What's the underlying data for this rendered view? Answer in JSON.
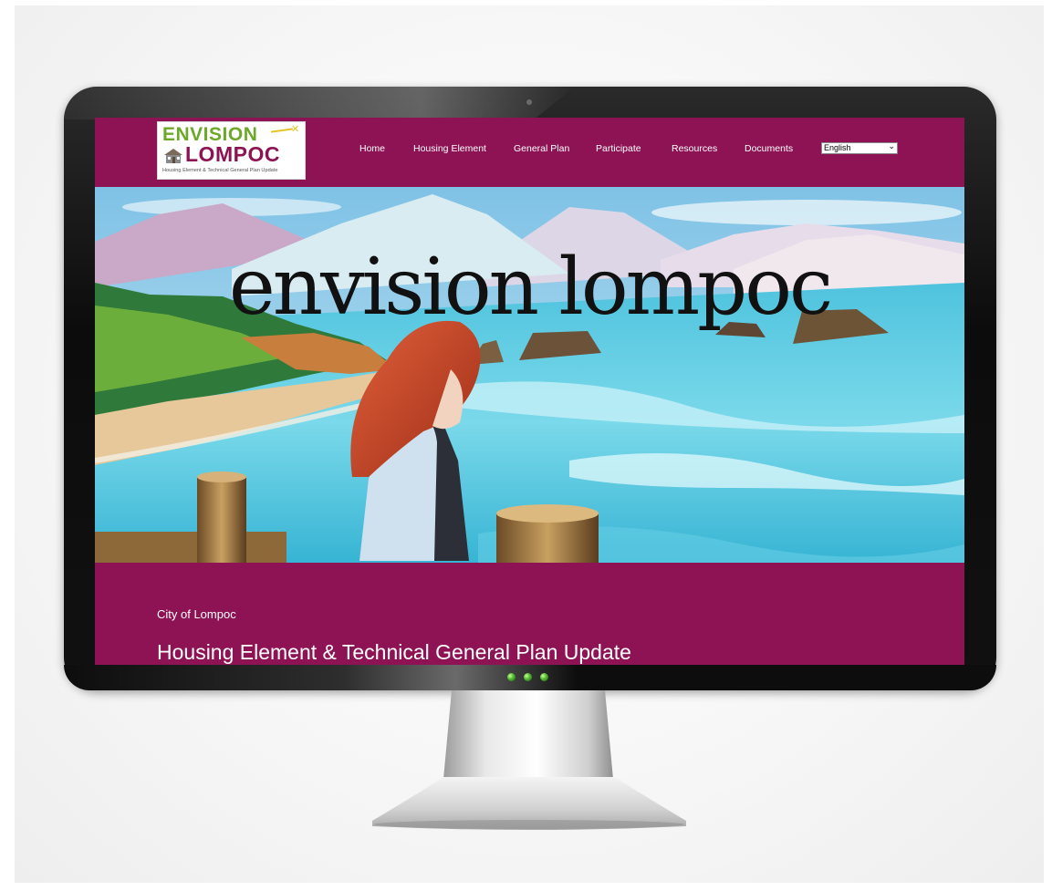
{
  "logo": {
    "line1": "ENVISION",
    "line2": "LOMPOC",
    "tagline": "Housing Element & Technical General Plan Update"
  },
  "nav": {
    "items": [
      {
        "label": "Home"
      },
      {
        "label": "Housing Element"
      },
      {
        "label": "General Plan"
      },
      {
        "label": "Participate"
      },
      {
        "label": "Resources"
      },
      {
        "label": "Documents"
      }
    ],
    "language": "English"
  },
  "hero": {
    "title": "envision lompoc"
  },
  "intro": {
    "subtitle": "City of Lompoc",
    "headline": "Housing Element & Technical General Plan Update"
  },
  "colors": {
    "brand_magenta": "#8d1354",
    "logo_green": "#6ea82a",
    "accent_yellow": "#e3c52a",
    "monitor_black": "#111111"
  },
  "icons": {
    "logo_house": "house-icon",
    "logo_star": "sparkle-icon",
    "dropdown": "chevron-down-icon",
    "power_lights": "status-led-icon"
  }
}
